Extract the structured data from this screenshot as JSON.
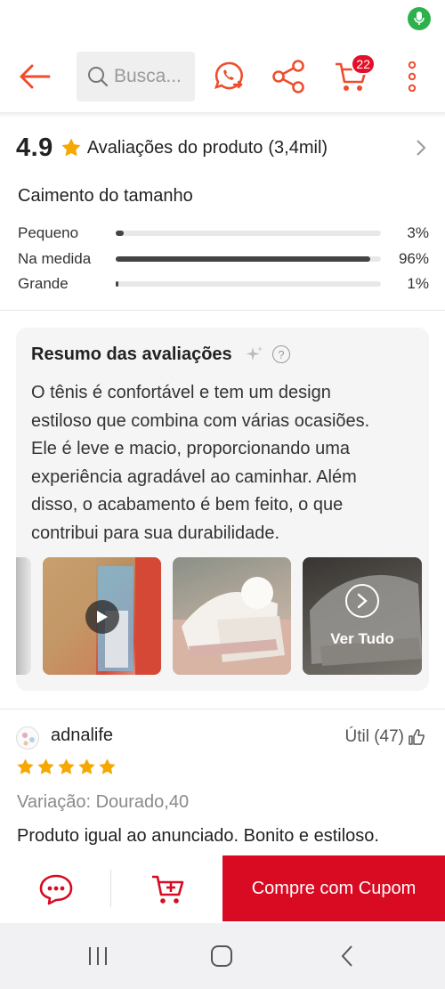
{
  "topbar": {
    "search_placeholder": "Busca...",
    "cart_count": "22"
  },
  "rating": {
    "score": "4.9",
    "title": "Avaliações do produto",
    "count": "(3,4mil)"
  },
  "fit": {
    "title": "Caimento do tamanho",
    "rows": [
      {
        "label": "Pequeno",
        "pct": "3%",
        "value": 0.03
      },
      {
        "label": "Na medida",
        "pct": "96%",
        "value": 0.96
      },
      {
        "label": "Grande",
        "pct": "1%",
        "value": 0.01
      }
    ]
  },
  "summary": {
    "title": "Resumo das avaliações",
    "help": "?",
    "lines": [
      "O tênis é confortável e tem um design",
      "estiloso que combina com várias ocasiões.",
      "Ele é leve e macio, proporcionando uma",
      "experiência agradável ao caminhar. Além",
      "disso, o acabamento é bem feito, o que",
      "contribui para sua durabilidade."
    ],
    "see_all": "Ver Tudo"
  },
  "review": {
    "username": "adnalife",
    "helpful": "Útil (47)",
    "stars": 5,
    "variation": "Variação: Dourado,40",
    "text": "Produto igual ao anunciado. Bonito e estiloso."
  },
  "actions": {
    "buy_label": "Compre com Cupom"
  },
  "colors": {
    "accent": "#ee4d2d",
    "buy": "#d80b23",
    "star": "#f6a700"
  }
}
